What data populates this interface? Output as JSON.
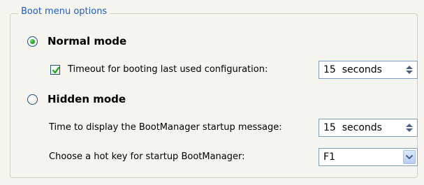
{
  "group": {
    "title": "Boot menu options"
  },
  "normal_mode": {
    "label": "Normal mode",
    "selected": true,
    "timeout_checkbox": {
      "label": "Timeout for booting last used configuration:",
      "checked": true
    },
    "timeout_value": "15  seconds"
  },
  "hidden_mode": {
    "label": "Hidden mode",
    "selected": false,
    "display_time_label": "Time to display the BootManager startup message:",
    "display_time_value": "15  seconds",
    "hotkey_label": "Choose a hot key for startup BootManager:",
    "hotkey_value": "F1"
  },
  "icons": {
    "radio_selected": "radio-selected-icon",
    "radio_unselected": "radio-unselected-icon",
    "checkbox_checked": "checkmark-icon",
    "spin": "spin-arrows-icon",
    "dropdown": "chevron-down-icon"
  },
  "colors": {
    "background": "#f5f4ee",
    "group_title": "#1f5cbf",
    "border": "#7f9db9",
    "radio_dot": "#21a121",
    "checkmark": "#21a121"
  }
}
